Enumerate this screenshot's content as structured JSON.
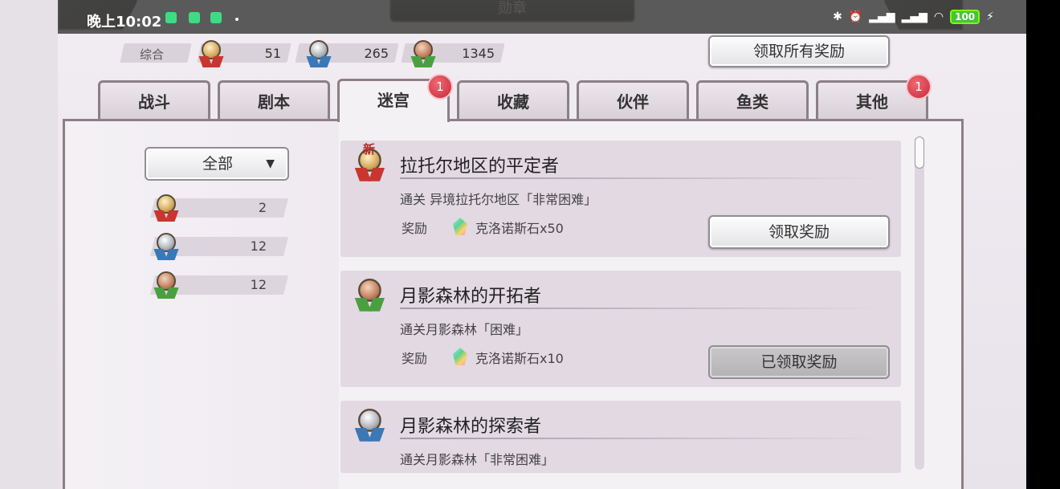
{
  "status_bar": {
    "time": "晚上10:02",
    "battery": "100"
  },
  "header": {
    "title": "勋章"
  },
  "summary": {
    "label": "综合",
    "gold_count": "51",
    "silver_count": "265",
    "bronze_count": "1345"
  },
  "claim_all_label": "领取所有奖励",
  "tabs": [
    {
      "label": "战斗"
    },
    {
      "label": "剧本"
    },
    {
      "label": "迷宫",
      "badge": "1",
      "active": true
    },
    {
      "label": "收藏"
    },
    {
      "label": "伙伴"
    },
    {
      "label": "鱼类"
    },
    {
      "label": "其他",
      "badge": "1"
    }
  ],
  "filter": {
    "selected": "全部",
    "arrow": "▼",
    "counts": {
      "gold": "2",
      "silver": "12",
      "bronze": "12"
    }
  },
  "achievements": [
    {
      "title": "拉托尔地区的平定者",
      "new_label": "新",
      "description": "通关 异境拉托尔地区「非常困难」",
      "reward_label": "奖励",
      "reward_item": "克洛诺斯石x50",
      "button": "领取奖励",
      "medal": "gold"
    },
    {
      "title": "月影森林的开拓者",
      "description": "通关月影森林「困难」",
      "reward_label": "奖励",
      "reward_item": "克洛诺斯石x10",
      "button": "已领取奖励",
      "medal": "bronze"
    },
    {
      "title": "月影森林的探索者",
      "description": "通关月影森林「非常困难」",
      "medal": "silver"
    }
  ],
  "colors": {
    "badge_red": "#d03a48",
    "panel_bg": "#f4f1f5",
    "card_bg": "#e2d9e3"
  },
  "icons": [
    "gold-medal-icon",
    "silver-medal-icon",
    "bronze-medal-icon",
    "chronos-stone-icon",
    "back-arrow-icon",
    "close-icon"
  ]
}
